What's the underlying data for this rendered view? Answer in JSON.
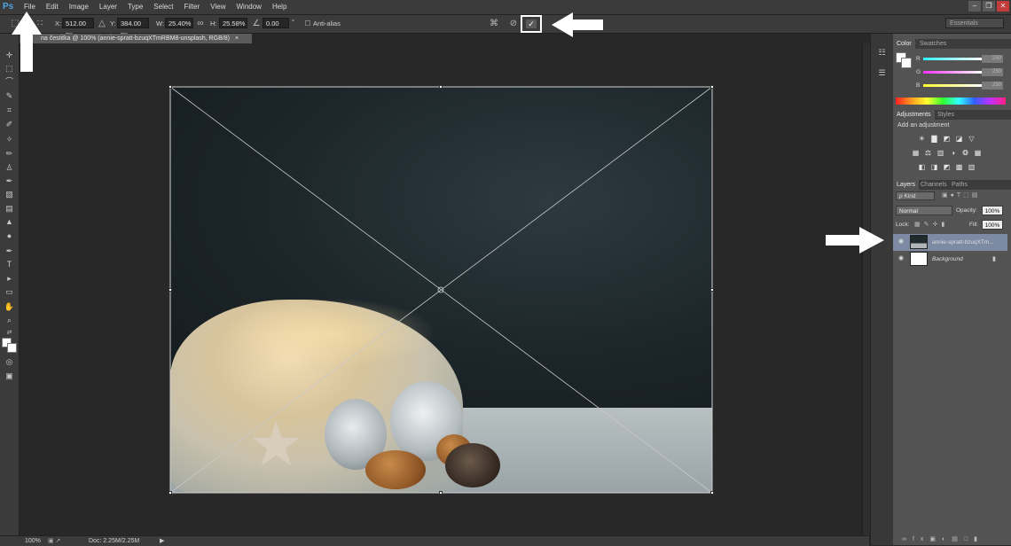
{
  "app": {
    "logo": "Ps"
  },
  "menu": [
    "File",
    "Edit",
    "Image",
    "Layer",
    "Type",
    "Select",
    "Filter",
    "View",
    "Window",
    "Help"
  ],
  "window_controls": {
    "minimize": "–",
    "restore": "❐",
    "close": "✕"
  },
  "options": {
    "x_label": "X:",
    "x_value": "512.00 px",
    "y_label": "Y:",
    "y_value": "384.00 px",
    "w_label": "W:",
    "w_value": "25.40%",
    "h_label": "H:",
    "h_value": "25.58%",
    "angle_value": "0.00",
    "angle_unit": "°",
    "antialias_label": "Anti-alias",
    "commit_icon": "✓",
    "cancel_icon": "⊘",
    "workspace": "Essentials"
  },
  "document": {
    "tab_title": "na čestitka @ 100% (annie-spratt-bzuqXTmRBM8-unsplash, RGB/8)",
    "tab_close": "×"
  },
  "status": {
    "zoom": "100%",
    "doc_info": "Doc: 2.25M/2.25M",
    "play_icon": "▶"
  },
  "color_panel": {
    "tabs": [
      "Color",
      "Swatches"
    ],
    "channels": [
      {
        "label": "R",
        "value": "250",
        "gradient": "#ff3030"
      },
      {
        "label": "G",
        "value": "250",
        "gradient": "#ff30ff"
      },
      {
        "label": "B",
        "value": "250",
        "gradient": "#ffff30"
      }
    ]
  },
  "adjustments_panel": {
    "tabs": [
      "Adjustments",
      "Styles"
    ],
    "title": "Add an adjustment"
  },
  "layers_panel": {
    "tabs": [
      "Layers",
      "Channels",
      "Paths"
    ],
    "filter": "ρ Kind",
    "blend_mode": "Normal",
    "opacity_label": "Opacity:",
    "opacity_value": "100%",
    "lock_label": "Lock:",
    "fill_label": "Fill:",
    "fill_value": "100%",
    "layers": [
      {
        "name": "annie-spratt-bzuqXTm...",
        "selected": true
      },
      {
        "name": "Background",
        "selected": false
      }
    ]
  },
  "colors": {
    "accent": "#4fa3e0",
    "selected_layer": "#7d8aa3",
    "panel_bg": "#535353",
    "chrome_bg": "#3b3b3b"
  }
}
